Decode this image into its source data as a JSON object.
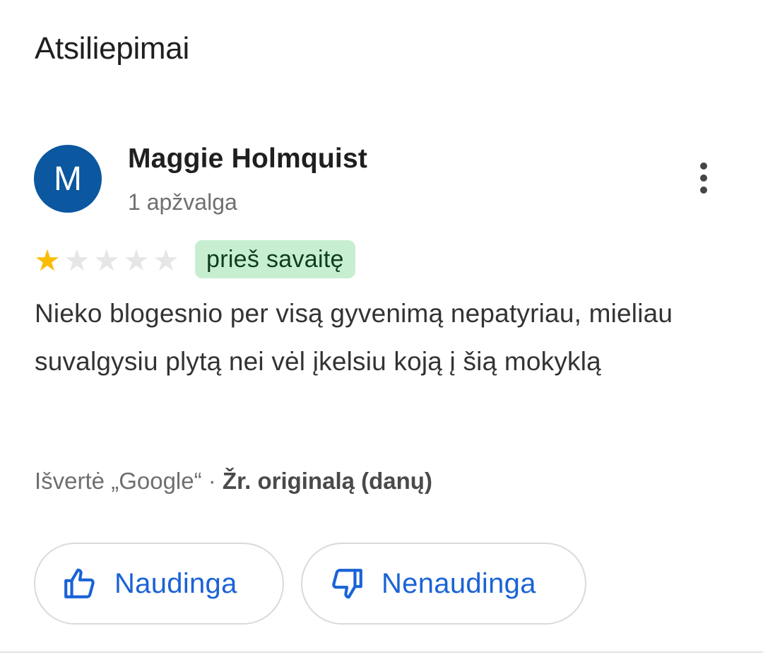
{
  "section": {
    "title": "Atsiliepimai"
  },
  "review": {
    "author": {
      "initial": "M",
      "name": "Maggie Holmquist",
      "meta": "1 apžvalga",
      "avatar_color": "#0b57a0"
    },
    "rating": {
      "value": 1,
      "max": 5,
      "filled_color": "#fbbc04",
      "empty_color": "#e6e6e6"
    },
    "time": "prieš savaitę",
    "time_badge_color": "#c8eed2",
    "text": "Nieko blogesnio per visą gyvenimą nepatyriau, mieliau suvalgysiu plytą nei vėl įkelsiu koją į šią mokyklą",
    "translation": {
      "note": "Išvertė „Google“ · ",
      "original_link": "Žr. originalą (danų)"
    },
    "actions": {
      "helpful_label": "Naudinga",
      "unhelpful_label": "Nenaudinga",
      "accent_color": "#1a63d6"
    },
    "more_icon": "more-vert-icon"
  }
}
